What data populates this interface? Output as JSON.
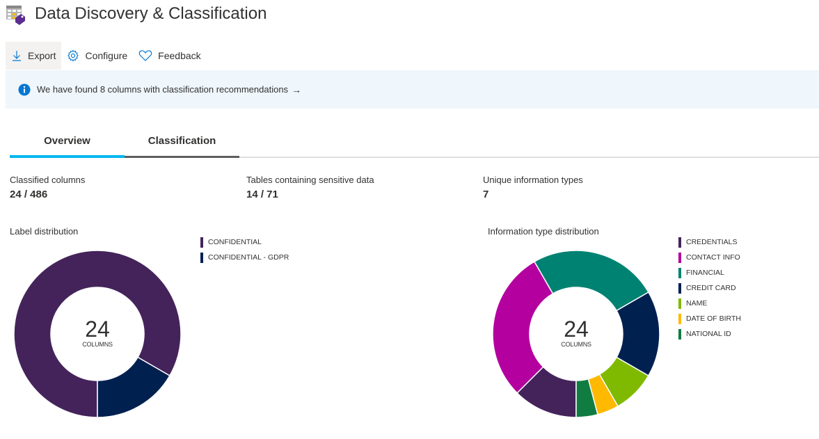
{
  "header": {
    "title": "Data Discovery & Classification",
    "icon": "data-classification-icon"
  },
  "toolbar": {
    "export_label": "Export",
    "configure_label": "Configure",
    "feedback_label": "Feedback"
  },
  "banner": {
    "text": "We have found 8 columns with classification recommendations",
    "arrow": "→",
    "icon": "info-icon"
  },
  "tabs": [
    {
      "label": "Overview",
      "active": true
    },
    {
      "label": "Classification",
      "active": false
    }
  ],
  "stats": [
    {
      "label": "Classified columns",
      "value": "24 / 486"
    },
    {
      "label": "Tables containing sensitive data",
      "value": "14 / 71"
    },
    {
      "label": "Unique information types",
      "value": "7"
    }
  ],
  "chart_data": [
    {
      "type": "pie",
      "title": "Label distribution",
      "center_value": "24",
      "center_label": "COLUMNS",
      "legend": "right",
      "categories": [
        "CONFIDENTIAL",
        "CONFIDENTIAL - GDPR"
      ],
      "values": [
        20,
        4
      ],
      "colors": [
        "#44235a",
        "#002050"
      ]
    },
    {
      "type": "pie",
      "title": "Information type distribution",
      "center_value": "24",
      "center_label": "COLUMNS",
      "legend": "right",
      "categories": [
        "CREDENTIALS",
        "CONTACT INFO",
        "FINANCIAL",
        "CREDIT CARD",
        "NAME",
        "DATE OF BIRTH",
        "NATIONAL ID"
      ],
      "values": [
        3,
        7,
        6,
        4,
        2,
        1,
        1
      ],
      "colors": [
        "#44235a",
        "#b4009e",
        "#008272",
        "#002050",
        "#7fba00",
        "#ffb900",
        "#107c41"
      ]
    }
  ]
}
